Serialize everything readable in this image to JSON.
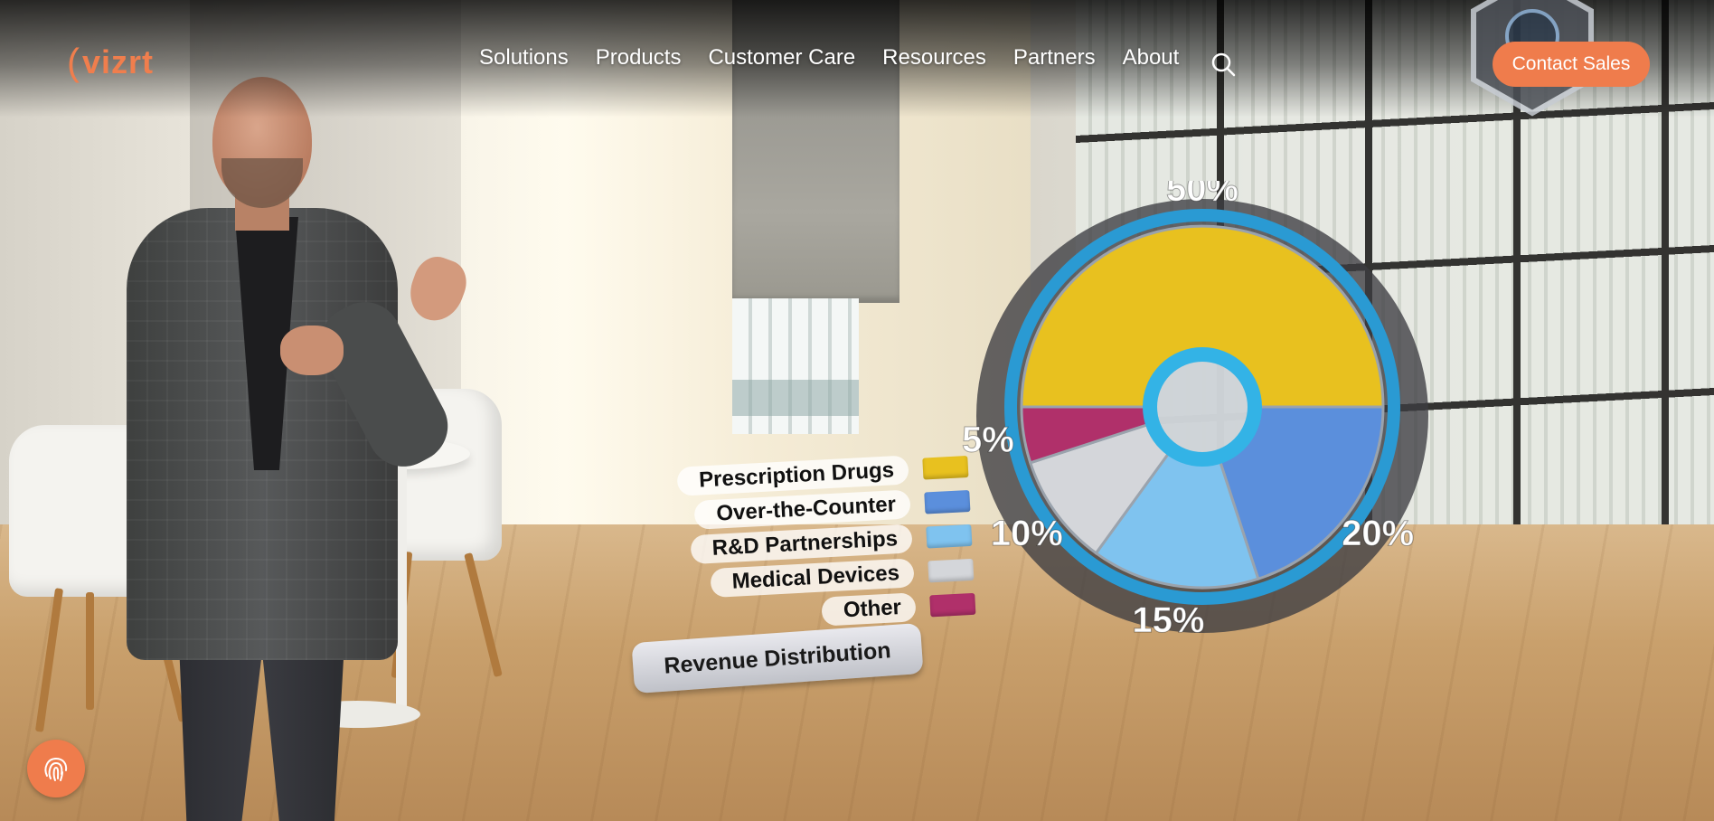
{
  "brand": {
    "logo_text": "vizrt",
    "accent": "#ef7c4c"
  },
  "nav": {
    "items": [
      {
        "label": "Solutions"
      },
      {
        "label": "Products"
      },
      {
        "label": "Customer Care"
      },
      {
        "label": "Resources"
      },
      {
        "label": "Partners"
      },
      {
        "label": "About"
      }
    ],
    "search_icon": "search-icon",
    "contact_label": "Contact Sales"
  },
  "graphic": {
    "caption": "Revenue Distribution",
    "legend": [
      {
        "label": "Prescription Drugs",
        "color": "#e8c11f"
      },
      {
        "label": "Over-the-Counter",
        "color": "#5b8fdc"
      },
      {
        "label": "R&D Partnerships",
        "color": "#7fc3ef"
      },
      {
        "label": "Medical Devices",
        "color": "#d4d6da"
      },
      {
        "label": "Other",
        "color": "#b0306a"
      }
    ]
  },
  "chart_data": {
    "type": "pie",
    "title": "Revenue Distribution",
    "categories": [
      "Prescription Drugs",
      "Over-the-Counter",
      "R&D Partnerships",
      "Medical Devices",
      "Other"
    ],
    "values": [
      50,
      20,
      15,
      10,
      5
    ],
    "value_labels": [
      "50%",
      "20%",
      "15%",
      "10%",
      "5%"
    ],
    "colors": [
      "#e8c11f",
      "#5b8fdc",
      "#7fc3ef",
      "#d4d6da",
      "#b0306a"
    ],
    "legend_position": "left"
  },
  "chat_widget": {
    "icon": "fingerprint-icon"
  }
}
